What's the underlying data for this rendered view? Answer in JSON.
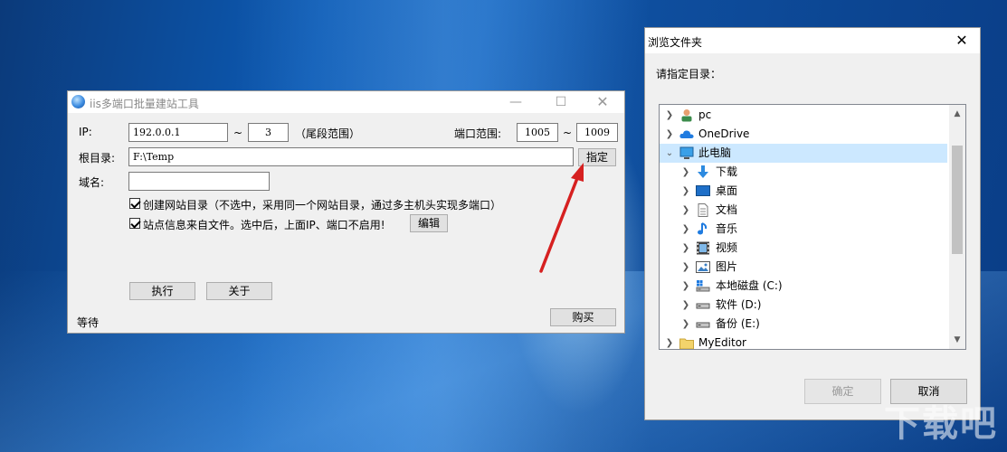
{
  "main_window": {
    "title": "iis多端口批量建站工具",
    "ip_label": "IP:",
    "ip_value": "192.0.0.1",
    "tilde": "~",
    "ip_end_value": "3",
    "ip_hint": "（尾段范围）",
    "port_label": "端口范围:",
    "port_start": "1005",
    "port_end": "1009",
    "root_label": "根目录:",
    "root_value": "F:\\Temp",
    "specify_button": "指定",
    "domain_label": "域名:",
    "domain_value": "",
    "checkbox1_label": "创建网站目录（不选中，采用同一个网站目录，通过多主机头实现多端口）",
    "checkbox1_checked": true,
    "checkbox2_label": "站点信息来自文件。选中后，上面IP、端口不启用!",
    "checkbox2_checked": true,
    "edit_button": "编辑",
    "run_button": "执行",
    "about_button": "关于",
    "status": "等待",
    "buy_button": "购买"
  },
  "browse_dialog": {
    "title": "浏览文件夹",
    "prompt": "请指定目录：",
    "tree": [
      {
        "label": "pc",
        "icon": "user-icon",
        "expander": ">"
      },
      {
        "label": "OneDrive",
        "icon": "cloud-icon",
        "expander": ">"
      },
      {
        "label": "此电脑",
        "icon": "computer-icon",
        "expander": "v",
        "selected": true
      },
      {
        "label": "下载",
        "icon": "download-icon",
        "expander": ">"
      },
      {
        "label": "桌面",
        "icon": "desktop-icon",
        "expander": ">"
      },
      {
        "label": "文档",
        "icon": "document-icon",
        "expander": ">"
      },
      {
        "label": "音乐",
        "icon": "music-icon",
        "expander": ">"
      },
      {
        "label": "视频",
        "icon": "video-icon",
        "expander": ">"
      },
      {
        "label": "图片",
        "icon": "picture-icon",
        "expander": ">"
      },
      {
        "label": "本地磁盘 (C:)",
        "icon": "windows-drive-icon",
        "expander": ">"
      },
      {
        "label": "软件 (D:)",
        "icon": "drive-icon",
        "expander": ">"
      },
      {
        "label": "备份 (E:)",
        "icon": "drive-icon",
        "expander": ">"
      },
      {
        "label": "MyEditor",
        "icon": "folder-icon",
        "expander": ">"
      }
    ],
    "ok_button": "确定",
    "cancel_button": "取消"
  },
  "watermark": "下载吧"
}
